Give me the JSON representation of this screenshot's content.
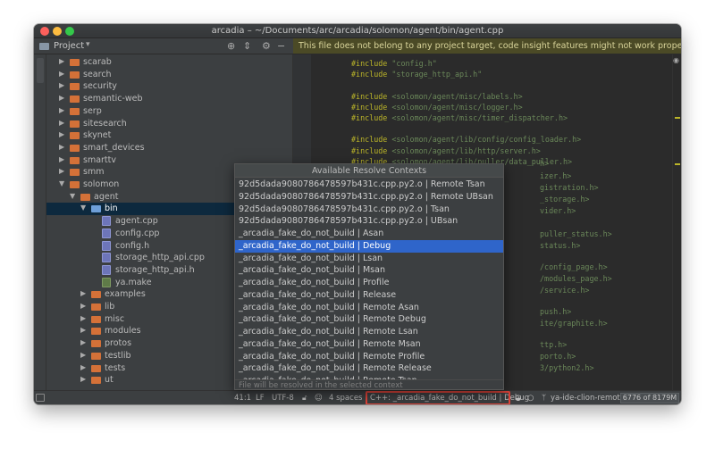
{
  "window": {
    "title": "arcadia – ~/Documents/arc/arcadia/solomon/agent/bin/agent.cpp"
  },
  "project_panel": {
    "title": "Project",
    "icons": [
      "target-icon",
      "collapse-all-icon",
      "gear-icon",
      "hide-icon"
    ]
  },
  "banner": {
    "text": "This file does not belong to any project target, code insight features might not work properly."
  },
  "tree": [
    {
      "label": "scarab",
      "depth": 0,
      "kind": "folder",
      "expanded": false
    },
    {
      "label": "search",
      "depth": 0,
      "kind": "folder",
      "expanded": false
    },
    {
      "label": "security",
      "depth": 0,
      "kind": "folder",
      "expanded": false
    },
    {
      "label": "semantic-web",
      "depth": 0,
      "kind": "folder",
      "expanded": false
    },
    {
      "label": "serp",
      "depth": 0,
      "kind": "folder",
      "expanded": false
    },
    {
      "label": "sitesearch",
      "depth": 0,
      "kind": "folder",
      "expanded": false
    },
    {
      "label": "skynet",
      "depth": 0,
      "kind": "folder",
      "expanded": false
    },
    {
      "label": "smart_devices",
      "depth": 0,
      "kind": "folder",
      "expanded": false
    },
    {
      "label": "smarttv",
      "depth": 0,
      "kind": "folder",
      "expanded": false
    },
    {
      "label": "smm",
      "depth": 0,
      "kind": "folder",
      "expanded": false
    },
    {
      "label": "solomon",
      "depth": 0,
      "kind": "folder",
      "expanded": true
    },
    {
      "label": "agent",
      "depth": 1,
      "kind": "folder",
      "expanded": true
    },
    {
      "label": "bin",
      "depth": 2,
      "kind": "folder-blue",
      "expanded": true,
      "selected": true
    },
    {
      "label": "agent.cpp",
      "depth": 3,
      "kind": "file"
    },
    {
      "label": "config.cpp",
      "depth": 3,
      "kind": "file"
    },
    {
      "label": "config.h",
      "depth": 3,
      "kind": "file"
    },
    {
      "label": "storage_http_api.cpp",
      "depth": 3,
      "kind": "file"
    },
    {
      "label": "storage_http_api.h",
      "depth": 3,
      "kind": "file"
    },
    {
      "label": "ya.make",
      "depth": 3,
      "kind": "file-make"
    },
    {
      "label": "examples",
      "depth": 2,
      "kind": "folder",
      "expanded": false
    },
    {
      "label": "lib",
      "depth": 2,
      "kind": "folder",
      "expanded": false
    },
    {
      "label": "misc",
      "depth": 2,
      "kind": "folder",
      "expanded": false
    },
    {
      "label": "modules",
      "depth": 2,
      "kind": "folder",
      "expanded": false
    },
    {
      "label": "protos",
      "depth": 2,
      "kind": "folder",
      "expanded": false
    },
    {
      "label": "testlib",
      "depth": 2,
      "kind": "folder",
      "expanded": false
    },
    {
      "label": "tests",
      "depth": 2,
      "kind": "folder",
      "expanded": false
    },
    {
      "label": "ut",
      "depth": 2,
      "kind": "folder",
      "expanded": false
    }
  ],
  "code": [
    {
      "kw": "#include",
      "path": "\"config.h\""
    },
    {
      "kw": "#include",
      "path": "\"storage_http_api.h\""
    },
    {
      "kw": "",
      "path": ""
    },
    {
      "kw": "#include",
      "path": "<solomon/agent/misc/labels.h>"
    },
    {
      "kw": "#include",
      "path": "<solomon/agent/misc/logger.h>"
    },
    {
      "kw": "#include",
      "path": "<solomon/agent/misc/timer_dispatcher.h>"
    },
    {
      "kw": "",
      "path": ""
    },
    {
      "kw": "#include",
      "path": "<solomon/agent/lib/config/config_loader.h>"
    },
    {
      "kw": "#include",
      "path": "<solomon/agent/lib/http/server.h>"
    },
    {
      "kw": "#include",
      "path": "<solomon/agent/lib/puller/data_puller.h>"
    }
  ],
  "code_fragments": [
    "h>",
    "izer.h>",
    "gistration.h>",
    "_storage.h>",
    "vider.h>",
    "puller_status.h>",
    "status.h>",
    "/config_page.h>",
    "/modules_page.h>",
    "/service.h>",
    "push.h>",
    "ite/graphite.h>",
    "ttp.h>",
    "porto.h>",
    "3/python2.h>"
  ],
  "popup": {
    "title": "Available Resolve Contexts",
    "items": [
      "92d5dada9080786478597b431c.cpp.py2.o | Remote Tsan",
      "92d5dada9080786478597b431c.cpp.py2.o | Remote UBsan",
      "92d5dada9080786478597b431c.cpp.py2.o | Tsan",
      "92d5dada9080786478597b431c.cpp.py2.o | UBsan",
      "_arcadia_fake_do_not_build | Asan",
      "_arcadia_fake_do_not_build | Debug",
      "_arcadia_fake_do_not_build | Lsan",
      "_arcadia_fake_do_not_build | Msan",
      "_arcadia_fake_do_not_build | Profile",
      "_arcadia_fake_do_not_build | Release",
      "_arcadia_fake_do_not_build | Remote Asan",
      "_arcadia_fake_do_not_build | Remote Debug",
      "_arcadia_fake_do_not_build | Remote Lsan",
      "_arcadia_fake_do_not_build | Remote Msan",
      "_arcadia_fake_do_not_build | Remote Profile",
      "_arcadia_fake_do_not_build | Remote Release",
      "_arcadia_fake_do_not_build | Remote Tsan"
    ],
    "selected_index": 5,
    "footer": "File will be resolved in the selected context"
  },
  "statusbar": {
    "position": "41:1",
    "line_sep": "LF",
    "encoding": "UTF-8",
    "indent": "4 spaces",
    "context": "C++: _arcadia_fake_do_not_build | Debug",
    "vcs_branch": "ya-ide-clion-remote",
    "memory": "6776 of 8179M"
  },
  "colors": {
    "accent": "#2f65ca",
    "highlight_box": "#e0443a",
    "folder": "#d47138",
    "banner_bg": "#4b4a26"
  }
}
